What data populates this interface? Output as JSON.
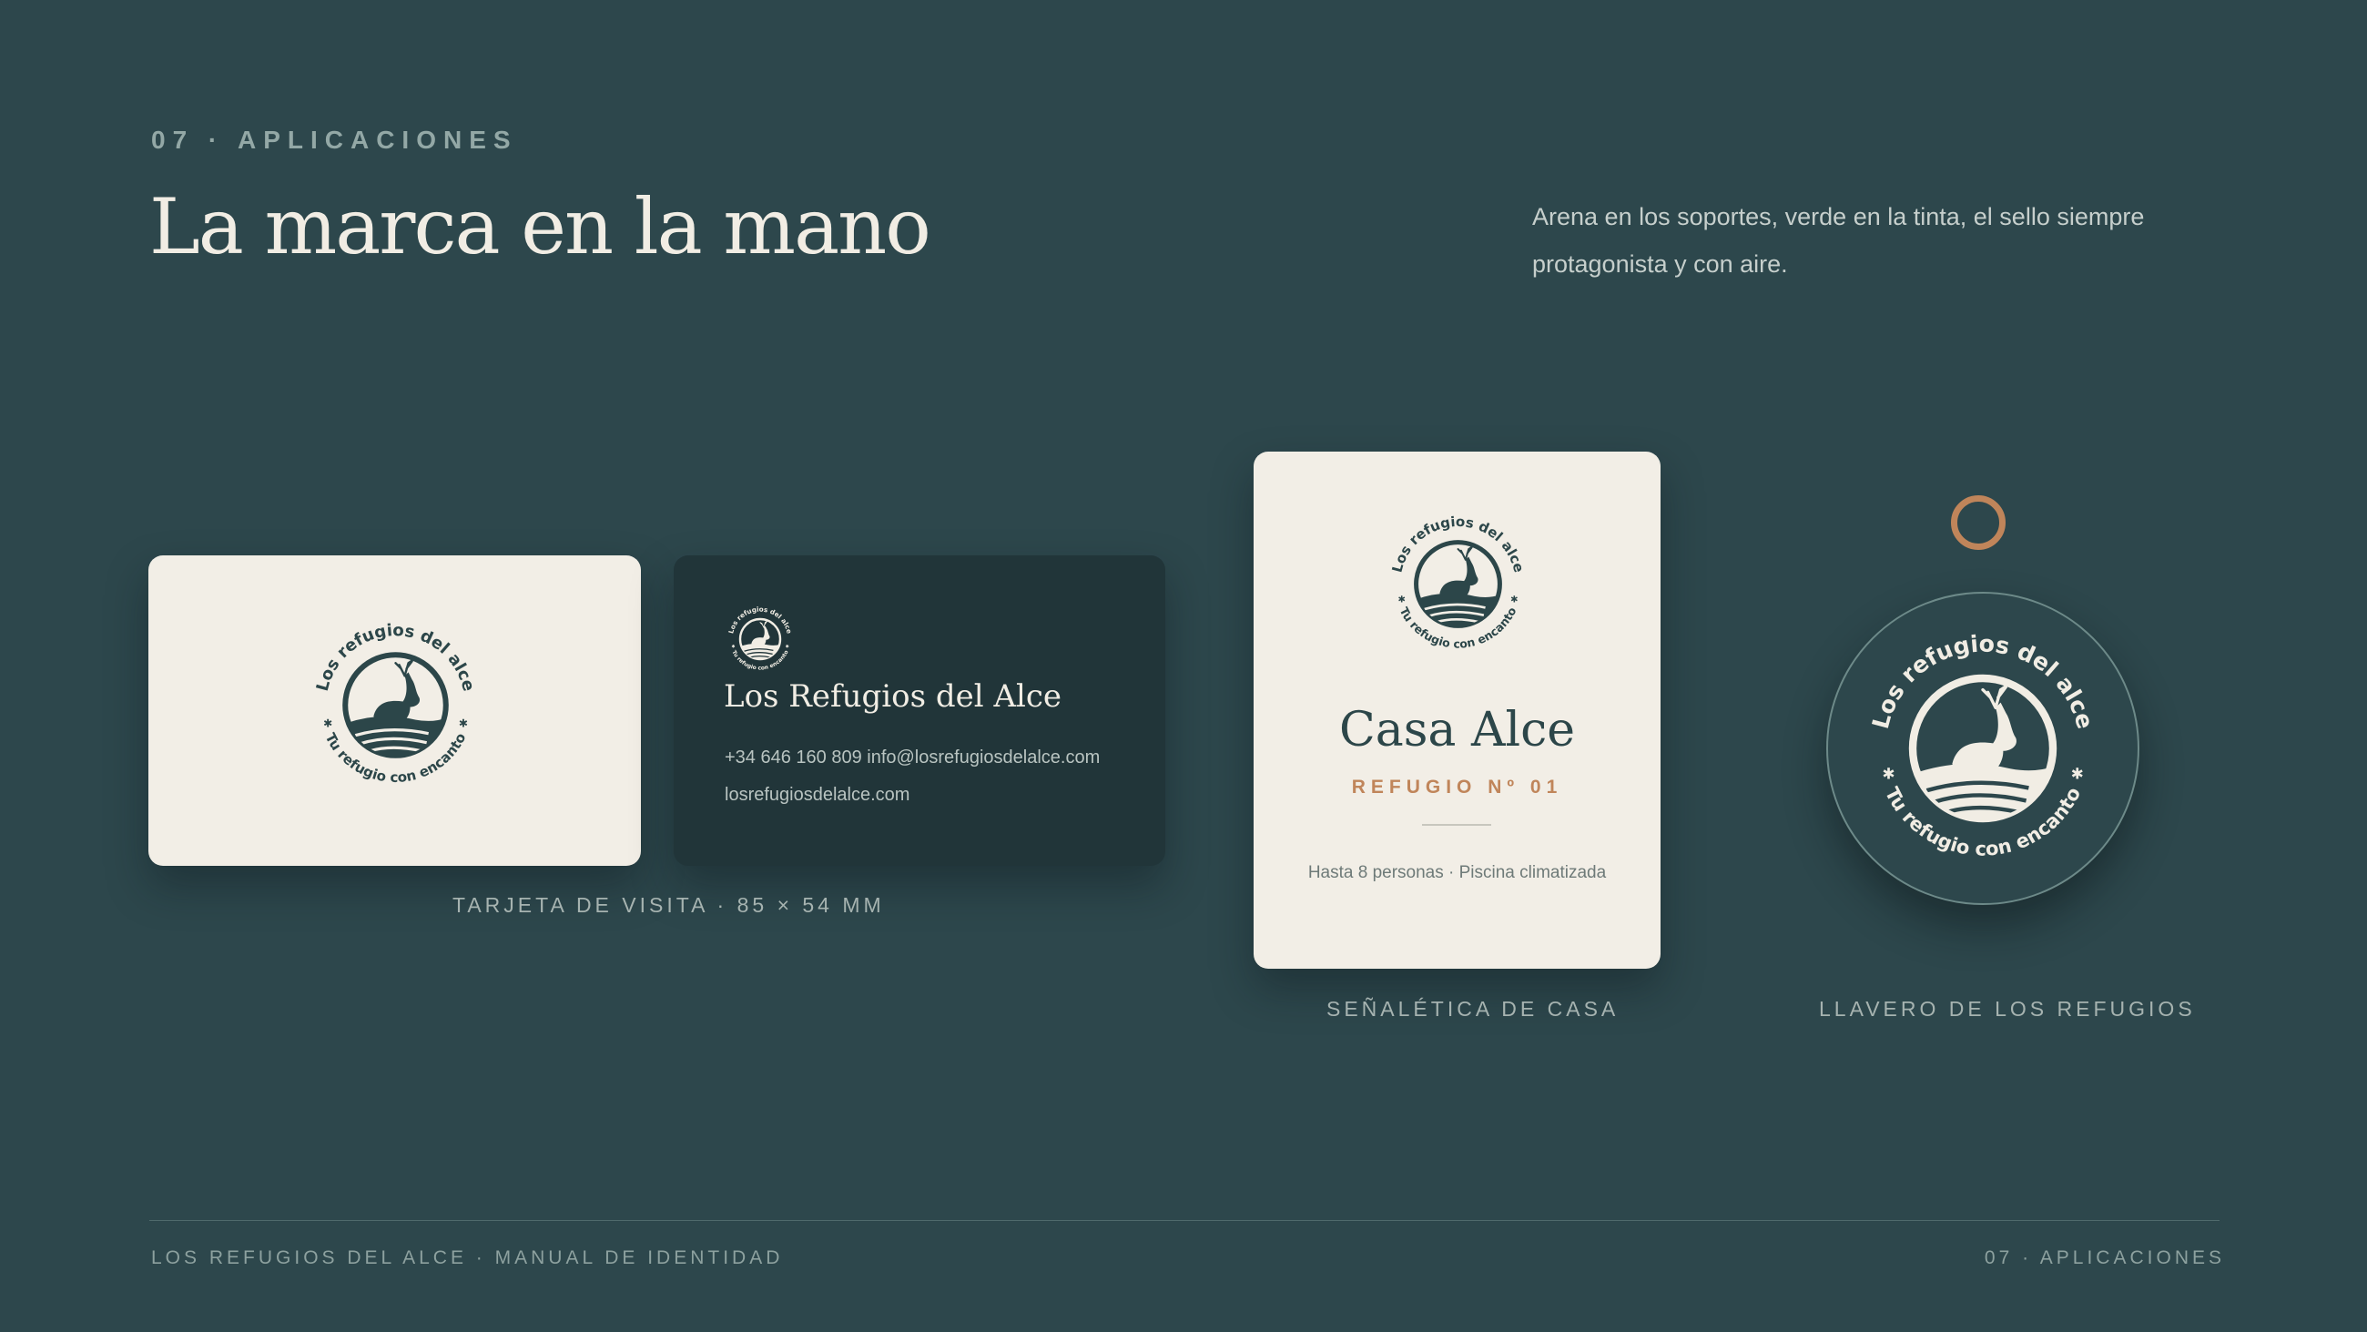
{
  "header": {
    "eyebrow": "07 · APLICACIONES",
    "title": "La marca en la mano",
    "intro": "Arena en los soportes, verde en la tinta, el sello siempre protagonista y con aire."
  },
  "seal": {
    "arc_top": "Los refugios del alce",
    "arc_bottom": "Tu refugio con encanto",
    "icon": "deer-icon"
  },
  "business_card": {
    "name": "Los Refugios del Alce",
    "phone_email": "+34 646 160 809 info@losrefugiosdelalce.com",
    "website": "losrefugiosdelalce.com",
    "caption": "TARJETA DE VISITA · 85 × 54 MM"
  },
  "signage": {
    "title": "Casa Alce",
    "subtitle": "REFUGIO Nº 01",
    "note": "Hasta 8 personas · Piscina climatizada",
    "caption": "SEÑALÉTICA DE CASA"
  },
  "keychain": {
    "caption": "LLAVERO DE LOS REFUGIOS"
  },
  "footer": {
    "left": "LOS REFUGIOS DEL ALCE · MANUAL DE IDENTIDAD",
    "right": "07 · APLICACIONES"
  },
  "colors": {
    "background": "#2d474c",
    "card_dark": "#213539",
    "sand": "#f2eee6",
    "ink": "#2c4649",
    "accent": "#c0855a"
  }
}
